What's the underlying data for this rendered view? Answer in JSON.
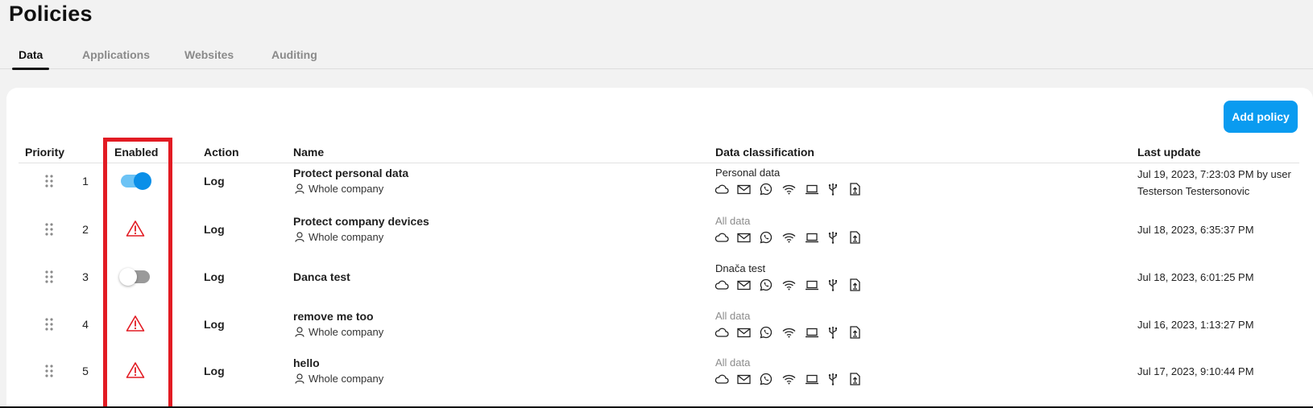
{
  "page": {
    "title": "Policies"
  },
  "tabs": [
    {
      "label": "Data",
      "active": true
    },
    {
      "label": "Applications",
      "active": false
    },
    {
      "label": "Websites",
      "active": false
    },
    {
      "label": "Auditing",
      "active": false
    }
  ],
  "toolbar": {
    "add_policy_label": "Add policy"
  },
  "table": {
    "headers": {
      "priority": "Priority",
      "enabled": "Enabled",
      "action": "Action",
      "name": "Name",
      "data_classification": "Data classification",
      "last_update": "Last update"
    },
    "channel_icons": [
      "cloud-icon",
      "mail-icon",
      "whatsapp-icon",
      "wifi-icon",
      "laptop-icon",
      "usb-icon",
      "file-upload-icon"
    ],
    "rows": [
      {
        "priority": "1",
        "enabled_state": "on",
        "action": "Log",
        "name": "Protect personal data",
        "scope": "Whole company",
        "classification": "Personal data",
        "classification_muted": false,
        "last_update_line1": "Jul 19, 2023, 7:23:03 PM by user",
        "last_update_line2": "Testerson Testersonovic"
      },
      {
        "priority": "2",
        "enabled_state": "warning",
        "action": "Log",
        "name": "Protect company devices",
        "scope": "Whole company",
        "classification": "All data",
        "classification_muted": true,
        "last_update_line1": "Jul 18, 2023, 6:35:37 PM",
        "last_update_line2": ""
      },
      {
        "priority": "3",
        "enabled_state": "off",
        "action": "Log",
        "name": "Danca test",
        "scope": "",
        "classification": "Dnača test",
        "classification_muted": false,
        "last_update_line1": "Jul 18, 2023, 6:01:25 PM",
        "last_update_line2": ""
      },
      {
        "priority": "4",
        "enabled_state": "warning",
        "action": "Log",
        "name": "remove me too",
        "scope": "Whole company",
        "classification": "All data",
        "classification_muted": true,
        "last_update_line1": "Jul 16, 2023, 1:13:27 PM",
        "last_update_line2": ""
      },
      {
        "priority": "5",
        "enabled_state": "warning",
        "action": "Log",
        "name": "hello",
        "scope": "Whole company",
        "classification": "All data",
        "classification_muted": true,
        "last_update_line1": "Jul 17, 2023, 9:10:44 PM",
        "last_update_line2": ""
      }
    ]
  },
  "colors": {
    "accent": "#0a9bf0",
    "toggle_on_track": "#6cc3f5",
    "toggle_on_knob": "#0a8fe8",
    "toggle_off_track": "#9a9a9a",
    "warning": "#e21b23",
    "highlight": "#e21b23"
  }
}
